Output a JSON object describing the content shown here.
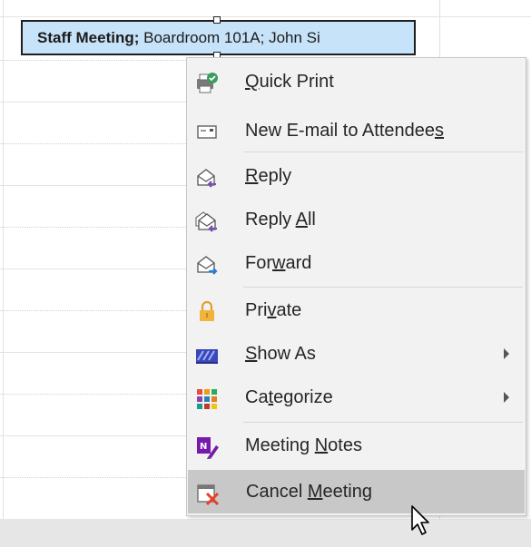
{
  "appointment": {
    "subject": "Staff Meeting;",
    "details": " Boardroom 101A; John Si"
  },
  "menu": {
    "items": [
      {
        "pre": "",
        "u": "Q",
        "post": "uick Print",
        "icon": "quick-print-icon"
      },
      {
        "pre": "New E-mail to Attendee",
        "u": "s",
        "post": "",
        "icon": "email-icon"
      },
      {
        "pre": "",
        "u": "R",
        "post": "eply",
        "icon": "reply-icon"
      },
      {
        "pre": "Reply ",
        "u": "A",
        "post": "ll",
        "icon": "reply-all-icon"
      },
      {
        "pre": "For",
        "u": "w",
        "post": "ard",
        "icon": "forward-icon"
      },
      {
        "pre": "Pri",
        "u": "v",
        "post": "ate",
        "icon": "lock-icon"
      },
      {
        "pre": "",
        "u": "S",
        "post": "how As",
        "icon": "show-as-icon",
        "submenu": true
      },
      {
        "pre": "Ca",
        "u": "t",
        "post": "egorize",
        "icon": "categorize-icon",
        "submenu": true
      },
      {
        "pre": "Meeting ",
        "u": "N",
        "post": "otes",
        "icon": "onenote-icon"
      },
      {
        "pre": "Cancel ",
        "u": "M",
        "post": "eeting",
        "icon": "cancel-meeting-icon",
        "selected": true
      }
    ]
  },
  "colors": {
    "appointment_fill": "#c7e3f9",
    "menu_bg": "#f2f2f2",
    "selected_bg": "#c8c8c8",
    "lock": "#f0b33c",
    "reply_accent": "#7a4fb0",
    "forward_accent": "#2b7cd3"
  }
}
